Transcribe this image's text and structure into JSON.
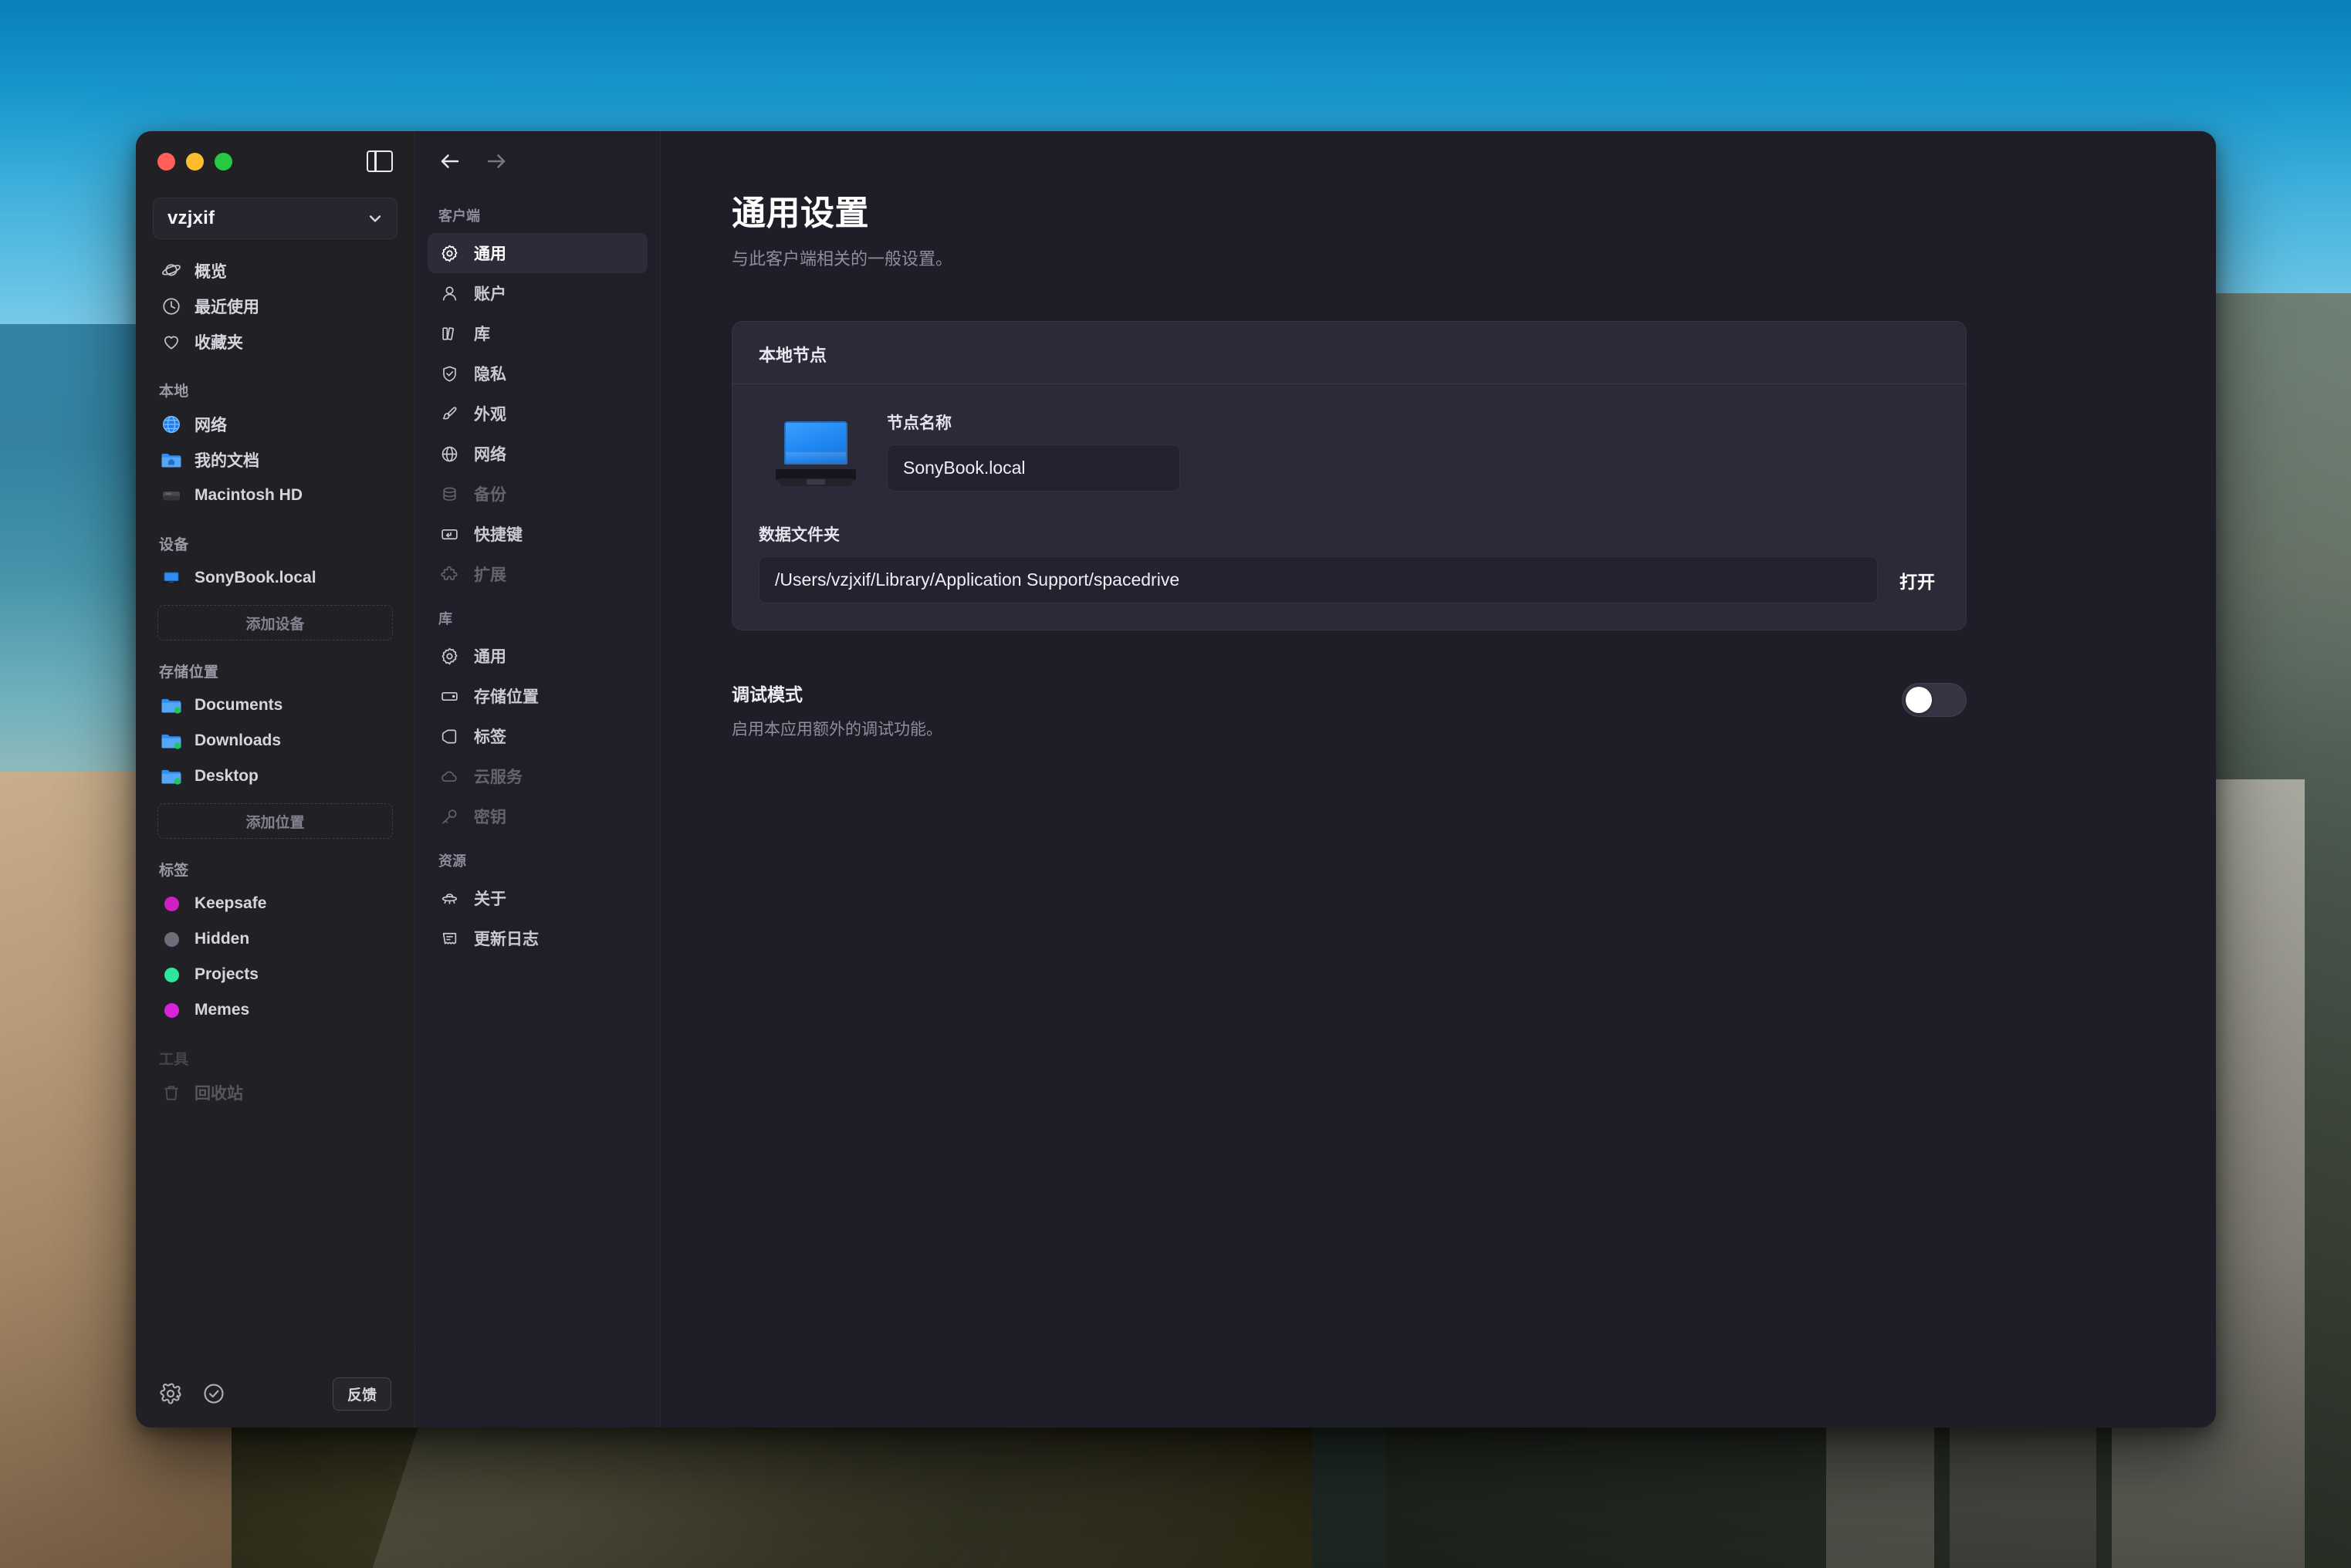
{
  "window": {
    "traffic_lights": [
      "close",
      "minimize",
      "maximize"
    ],
    "panel_toggle_icon": "sidebar-toggle-icon"
  },
  "sidebar": {
    "library_name": "vzjxif",
    "library_chevron_icon": "chevron-down-icon",
    "nav_items": [
      {
        "label": "概览",
        "icon": "planet-icon"
      },
      {
        "label": "最近使用",
        "icon": "clock-icon"
      },
      {
        "label": "收藏夹",
        "icon": "heart-icon"
      }
    ],
    "sections": [
      {
        "title": "本地",
        "items": [
          {
            "label": "网络",
            "icon": "globe-icon"
          },
          {
            "label": "我的文档",
            "icon": "home-folder-icon"
          },
          {
            "label": "Macintosh HD",
            "icon": "hard-drive-icon"
          }
        ]
      },
      {
        "title": "设备",
        "items": [
          {
            "label": "SonyBook.local",
            "icon": "laptop-icon"
          }
        ],
        "add_button": "添加设备"
      },
      {
        "title": "存储位置",
        "items": [
          {
            "label": "Documents",
            "icon": "folder-icon"
          },
          {
            "label": "Downloads",
            "icon": "folder-icon"
          },
          {
            "label": "Desktop",
            "icon": "folder-icon"
          }
        ],
        "add_button": "添加位置"
      },
      {
        "title": "标签",
        "tags": [
          {
            "label": "Keepsafe",
            "color": "#cf21c3"
          },
          {
            "label": "Hidden",
            "color": "#6e6e7a"
          },
          {
            "label": "Projects",
            "color": "#2ee6a0"
          },
          {
            "label": "Memes",
            "color": "#d823d8"
          }
        ]
      },
      {
        "title": "工具",
        "items": [
          {
            "label": "回收站",
            "icon": "trash-icon"
          }
        ]
      }
    ],
    "bottom_bar": {
      "settings_icon": "gear-icon",
      "jobs_icon": "check-circle-icon",
      "feedback_label": "反馈"
    }
  },
  "settings_nav": {
    "back_icon": "arrow-left-icon",
    "forward_icon": "arrow-right-icon",
    "groups": [
      {
        "title": "客户端",
        "items": [
          {
            "label": "通用",
            "icon": "gear-icon",
            "active": true,
            "disabled": false
          },
          {
            "label": "账户",
            "icon": "user-icon",
            "active": false,
            "disabled": false
          },
          {
            "label": "库",
            "icon": "books-icon",
            "active": false,
            "disabled": false
          },
          {
            "label": "隐私",
            "icon": "shield-check-icon",
            "active": false,
            "disabled": false
          },
          {
            "label": "外观",
            "icon": "paintbrush-icon",
            "active": false,
            "disabled": false
          },
          {
            "label": "网络",
            "icon": "globe-icon",
            "active": false,
            "disabled": false
          },
          {
            "label": "备份",
            "icon": "database-icon",
            "active": false,
            "disabled": true
          },
          {
            "label": "快捷键",
            "icon": "keyboard-key-icon",
            "active": false,
            "disabled": false
          },
          {
            "label": "扩展",
            "icon": "puzzle-icon",
            "active": false,
            "disabled": true
          }
        ]
      },
      {
        "title": "库",
        "items": [
          {
            "label": "通用",
            "icon": "gear-icon",
            "active": false,
            "disabled": false
          },
          {
            "label": "存储位置",
            "icon": "hard-drive-icon",
            "active": false,
            "disabled": false
          },
          {
            "label": "标签",
            "icon": "tag-icon",
            "active": false,
            "disabled": false
          },
          {
            "label": "云服务",
            "icon": "cloud-icon",
            "active": false,
            "disabled": true
          },
          {
            "label": "密钥",
            "icon": "key-icon",
            "active": false,
            "disabled": true
          }
        ]
      },
      {
        "title": "资源",
        "items": [
          {
            "label": "关于",
            "icon": "ufo-icon",
            "active": false,
            "disabled": false
          },
          {
            "label": "更新日志",
            "icon": "receipt-icon",
            "active": false,
            "disabled": false
          }
        ]
      }
    ]
  },
  "main": {
    "title": "通用设置",
    "subtitle": "与此客户端相关的一般设置。",
    "local_node_card": {
      "title": "本地节点",
      "device_icon": "laptop-icon",
      "node_name_label": "节点名称",
      "node_name_value": "SonyBook.local",
      "data_folder_label": "数据文件夹",
      "data_folder_value": "/Users/vzjxif/Library/Application Support/spacedrive",
      "open_button": "打开"
    },
    "debug_mode": {
      "title": "调试模式",
      "description": "启用本应用额外的调试功能。",
      "enabled": false
    }
  },
  "colors": {
    "window_bg": "#1e1e29",
    "sidebar_bg": "#212125",
    "settings_nav_bg": "#1f1f29",
    "card_bg": "#2a2a38",
    "input_bg": "#232330",
    "accent_blue": "#2f8cf0",
    "active_item_bg": "#2c2c38"
  }
}
